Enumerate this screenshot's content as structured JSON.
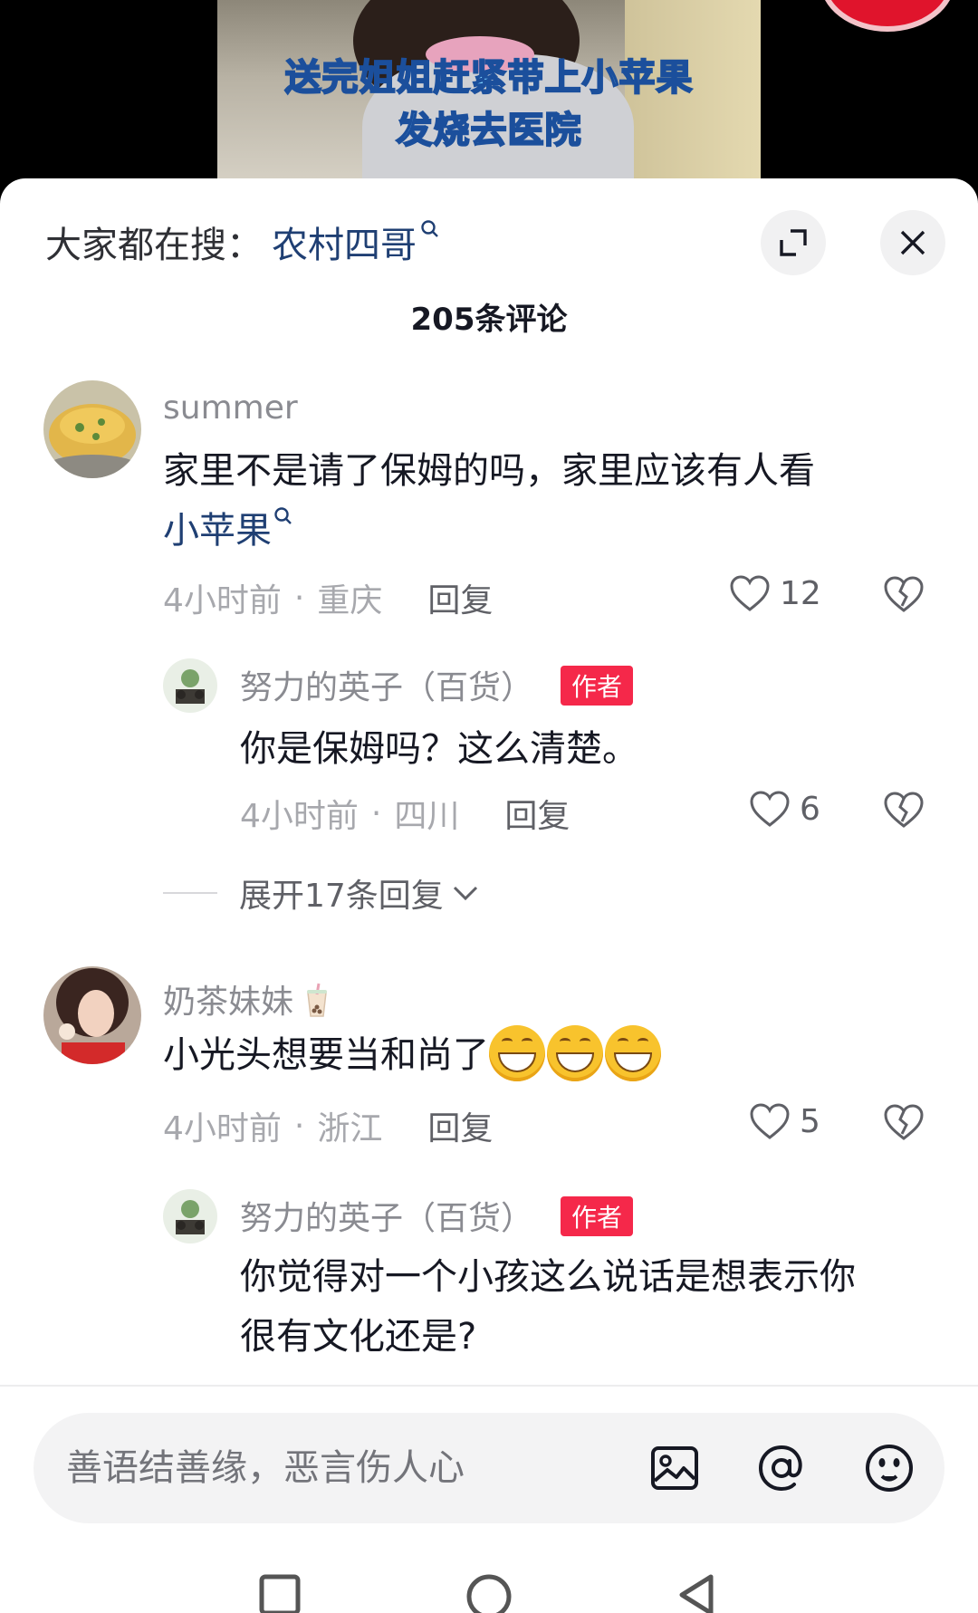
{
  "video": {
    "caption_line1": "送完姐姐赶紧带上小苹果",
    "caption_line2": "发烧去医院"
  },
  "header": {
    "search_prefix": "大家都在搜：",
    "search_term": "农村四哥",
    "comment_count": "205条评论"
  },
  "comments": [
    {
      "username": "summer",
      "text_line1": "家里不是请了保姆的吗，家里应该有人看",
      "text_line2": "小苹果",
      "time": "4小时前",
      "location": "重庆",
      "reply_label": "回复",
      "likes": "12",
      "reply": {
        "username": "努力的英子（百货）",
        "tag": "作者",
        "text": "你是保姆吗？这么清楚。",
        "time": "4小时前",
        "location": "四川",
        "reply_label": "回复",
        "likes": "6"
      },
      "expand_label": "展开17条回复"
    },
    {
      "username": "奶茶妹妹",
      "text": "小光头想要当和尚了",
      "time": "4小时前",
      "location": "浙江",
      "reply_label": "回复",
      "likes": "5",
      "reply": {
        "username": "努力的英子（百货）",
        "tag": "作者",
        "text_line1": "你觉得对一个小孩这么说话是想表示你",
        "text_line2": "很有文化还是?"
      }
    }
  ],
  "input": {
    "placeholder": "善语结善缘，恶言伤人心"
  },
  "colors": {
    "author_tag": "#f5284a",
    "link": "#1f3f73",
    "meta": "#a7a8ad"
  }
}
